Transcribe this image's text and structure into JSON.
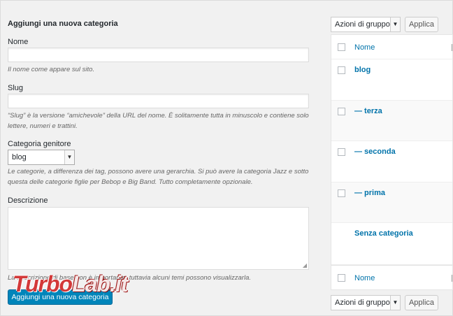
{
  "form": {
    "title": "Aggiungi una nuova categoria",
    "name_label": "Nome",
    "name_value": "",
    "name_help": "Il nome come appare sul sito.",
    "slug_label": "Slug",
    "slug_value": "",
    "slug_help": "“Slug” è la versione “amichevole” della URL del nome. È solitamente tutta in minuscolo e contiene solo lettere, numeri e trattini.",
    "parent_label": "Categoria genitore",
    "parent_selected": "blog",
    "parent_help": "Le categorie, a differenza dei tag, possono avere una gerarchia. Si può avere la categoria Jazz e sotto questa delle categorie figlie per Bebop e Big Band. Tutto completamente opzionale.",
    "description_label": "Descrizione",
    "description_value": "",
    "description_help": "La descrizione di base non è importante, tuttavia alcuni temi possono visualizzarla.",
    "submit_label": "Aggiungi una nuova categoria"
  },
  "watermark": {
    "part1": "Turbo",
    "part2": "Lab.it"
  },
  "list": {
    "bulk_action_top": "Azioni di gruppo",
    "apply_top": "Applica",
    "header_name": "Nome",
    "rows": [
      {
        "name": "blog"
      },
      {
        "name": "— terza"
      },
      {
        "name": "— seconda"
      },
      {
        "name": "— prima"
      },
      {
        "name": "Senza categoria"
      }
    ],
    "footer_name": "Nome",
    "bulk_action_bottom": "Azioni di gruppo",
    "apply_bottom": "Applica"
  },
  "colors": {
    "link": "#0073aa",
    "primary_button": "#0085ba",
    "watermark": "#cd1e1e"
  }
}
